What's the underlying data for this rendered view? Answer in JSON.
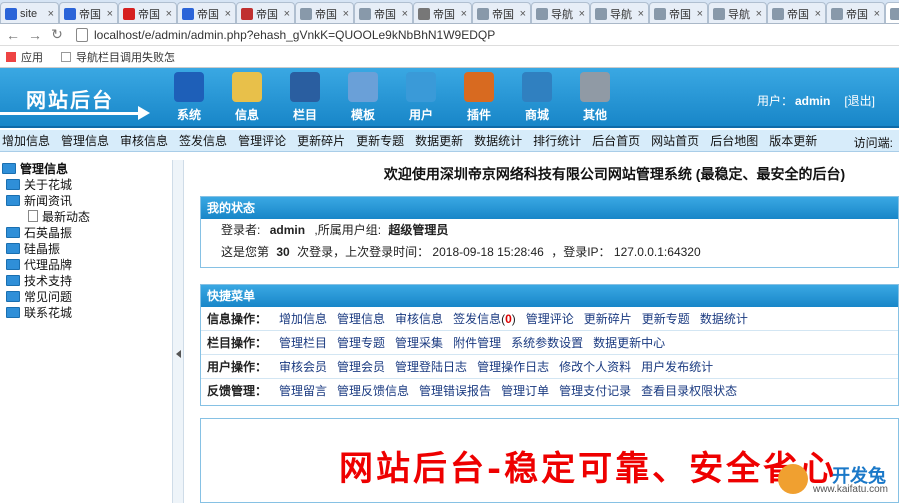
{
  "browser": {
    "tabs": [
      {
        "title": "site",
        "fav": "baidu-paw-icon",
        "color": "#2b64d8"
      },
      {
        "title": "帝国",
        "fav": "baidu-paw-icon",
        "color": "#2b64d8"
      },
      {
        "title": "帝国",
        "fav": "red-c-icon",
        "color": "#d62020"
      },
      {
        "title": "帝国",
        "fav": "baidu-paw-icon",
        "color": "#2b64d8"
      },
      {
        "title": "帝国",
        "fav": "red-globe-icon",
        "color": "#c03030"
      },
      {
        "title": "帝国",
        "fav": "page-icon",
        "color": "#8899aa"
      },
      {
        "title": "帝国",
        "fav": "page-icon",
        "color": "#8899aa"
      },
      {
        "title": "帝国",
        "fav": "gear-icon",
        "color": "#777777"
      },
      {
        "title": "帝国",
        "fav": "page-icon",
        "color": "#8899aa"
      },
      {
        "title": "导航",
        "fav": "page-icon",
        "color": "#8899aa"
      },
      {
        "title": "导航",
        "fav": "page-icon",
        "color": "#8899aa"
      },
      {
        "title": "帝国",
        "fav": "page-icon",
        "color": "#8899aa"
      },
      {
        "title": "导航",
        "fav": "page-icon",
        "color": "#8899aa"
      },
      {
        "title": "帝国",
        "fav": "page-icon",
        "color": "#8899aa"
      },
      {
        "title": "帝国",
        "fav": "page-icon",
        "color": "#8899aa"
      },
      {
        "title": "深圳",
        "fav": "page-icon",
        "color": "#8899aa",
        "active": true
      }
    ],
    "url": "localhost/e/admin/admin.php?ehash_gVnkK=QUOOLe9kNbBhN1W9EDQP",
    "bookmarks": [
      {
        "label": "应用",
        "color": "#e44"
      },
      {
        "label": "导航栏目调用失败怎",
        "color": "#bbb"
      }
    ]
  },
  "header": {
    "logo": "网站后台",
    "menu": [
      {
        "label": "系统",
        "icon": "globe-icon",
        "color": "#1e5fb8"
      },
      {
        "label": "信息",
        "icon": "notepad-icon",
        "color": "#e8c04a"
      },
      {
        "label": "栏目",
        "icon": "folder-icon",
        "color": "#2a5ea0"
      },
      {
        "label": "模板",
        "icon": "window-icon",
        "color": "#6aa0d8"
      },
      {
        "label": "用户",
        "icon": "user-icon",
        "color": "#3a9ad8"
      },
      {
        "label": "插件",
        "icon": "tools-icon",
        "color": "#d86a20"
      },
      {
        "label": "商城",
        "icon": "card-icon",
        "color": "#3080c0"
      },
      {
        "label": "其他",
        "icon": "gear-icon",
        "color": "#909aa5"
      }
    ],
    "user_label": "用户：",
    "user_name": "admin",
    "logout": "[退出]"
  },
  "submenu": {
    "items": [
      "增加信息",
      "管理信息",
      "审核信息",
      "签发信息",
      "管理评论",
      "更新碎片",
      "更新专题",
      "数据更新",
      "数据统计",
      "排行统计",
      "后台首页",
      "网站首页",
      "后台地图",
      "版本更新"
    ],
    "visit": "访问端:"
  },
  "tree": {
    "root": "管理信息",
    "nodes": [
      {
        "label": "关于花城",
        "type": "folder"
      },
      {
        "label": "新闻资讯",
        "type": "folder-open"
      },
      {
        "label": "最新动态",
        "type": "doc"
      },
      {
        "label": "石英晶振",
        "type": "folder"
      },
      {
        "label": "硅晶振",
        "type": "folder"
      },
      {
        "label": "代理品牌",
        "type": "folder"
      },
      {
        "label": "技术支持",
        "type": "folder"
      },
      {
        "label": "常见问题",
        "type": "folder"
      },
      {
        "label": "联系花城",
        "type": "folder"
      }
    ]
  },
  "main": {
    "welcome": "欢迎使用深圳帝京网络科技有限公司网站管理系统 (最稳定、最安全的后台)",
    "status": {
      "title": "我的状态",
      "login_prefix": "登录者:",
      "login_user": "admin",
      "group_prefix": ",所属用户组:",
      "group": "超级管理员",
      "count_prefix": "这是您第",
      "count": "30",
      "count_suffix": "次登录，上次登录时间：",
      "last_time": "2018-09-18 15:28:46",
      "ip_prefix": "，登录IP：",
      "ip": "127.0.0.1:64320"
    },
    "quick": {
      "title": "快捷菜单",
      "rows": [
        {
          "label": "信息操作：",
          "items": [
            "增加信息",
            "管理信息",
            "审核信息",
            "签发信息",
            "管理评论",
            "更新碎片",
            "更新专题",
            "数据统计"
          ],
          "badge_index": 3,
          "badge": "0"
        },
        {
          "label": "栏目操作：",
          "items": [
            "管理栏目",
            "管理专题",
            "管理采集",
            "附件管理",
            "系统参数设置",
            "数据更新中心"
          ]
        },
        {
          "label": "用户操作：",
          "items": [
            "审核会员",
            "管理会员",
            "管理登陆日志",
            "管理操作日志",
            "修改个人资料",
            "用户发布统计"
          ]
        },
        {
          "label": "反馈管理：",
          "items": [
            "管理留言",
            "管理反馈信息",
            "管理错误报告",
            "管理订单",
            "管理支付记录",
            "查看目录权限状态"
          ]
        }
      ]
    },
    "banner": "网站后台-稳定可靠、安全省心",
    "watermark": {
      "title": "开发兔",
      "url": "www.kaifatu.com"
    }
  }
}
